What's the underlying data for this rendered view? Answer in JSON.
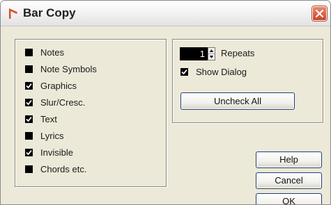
{
  "window": {
    "title": "Bar Copy",
    "accent_color": "#d4502e",
    "close_icon": "close-icon"
  },
  "left_panel": {
    "options": [
      {
        "label": "Notes",
        "checked": false
      },
      {
        "label": "Note Symbols",
        "checked": false
      },
      {
        "label": "Graphics",
        "checked": true
      },
      {
        "label": "Slur/Cresc.",
        "checked": true
      },
      {
        "label": "Text",
        "checked": true
      },
      {
        "label": "Lyrics",
        "checked": false
      },
      {
        "label": "Invisible",
        "checked": true
      },
      {
        "label": "Chords etc.",
        "checked": false
      }
    ]
  },
  "right_panel": {
    "repeats_value": "1",
    "repeats_label": "Repeats",
    "show_dialog_label": "Show Dialog",
    "show_dialog_checked": true,
    "uncheck_all_label": "Uncheck All"
  },
  "buttons": {
    "help": "Help",
    "cancel": "Cancel",
    "ok": "OK"
  }
}
